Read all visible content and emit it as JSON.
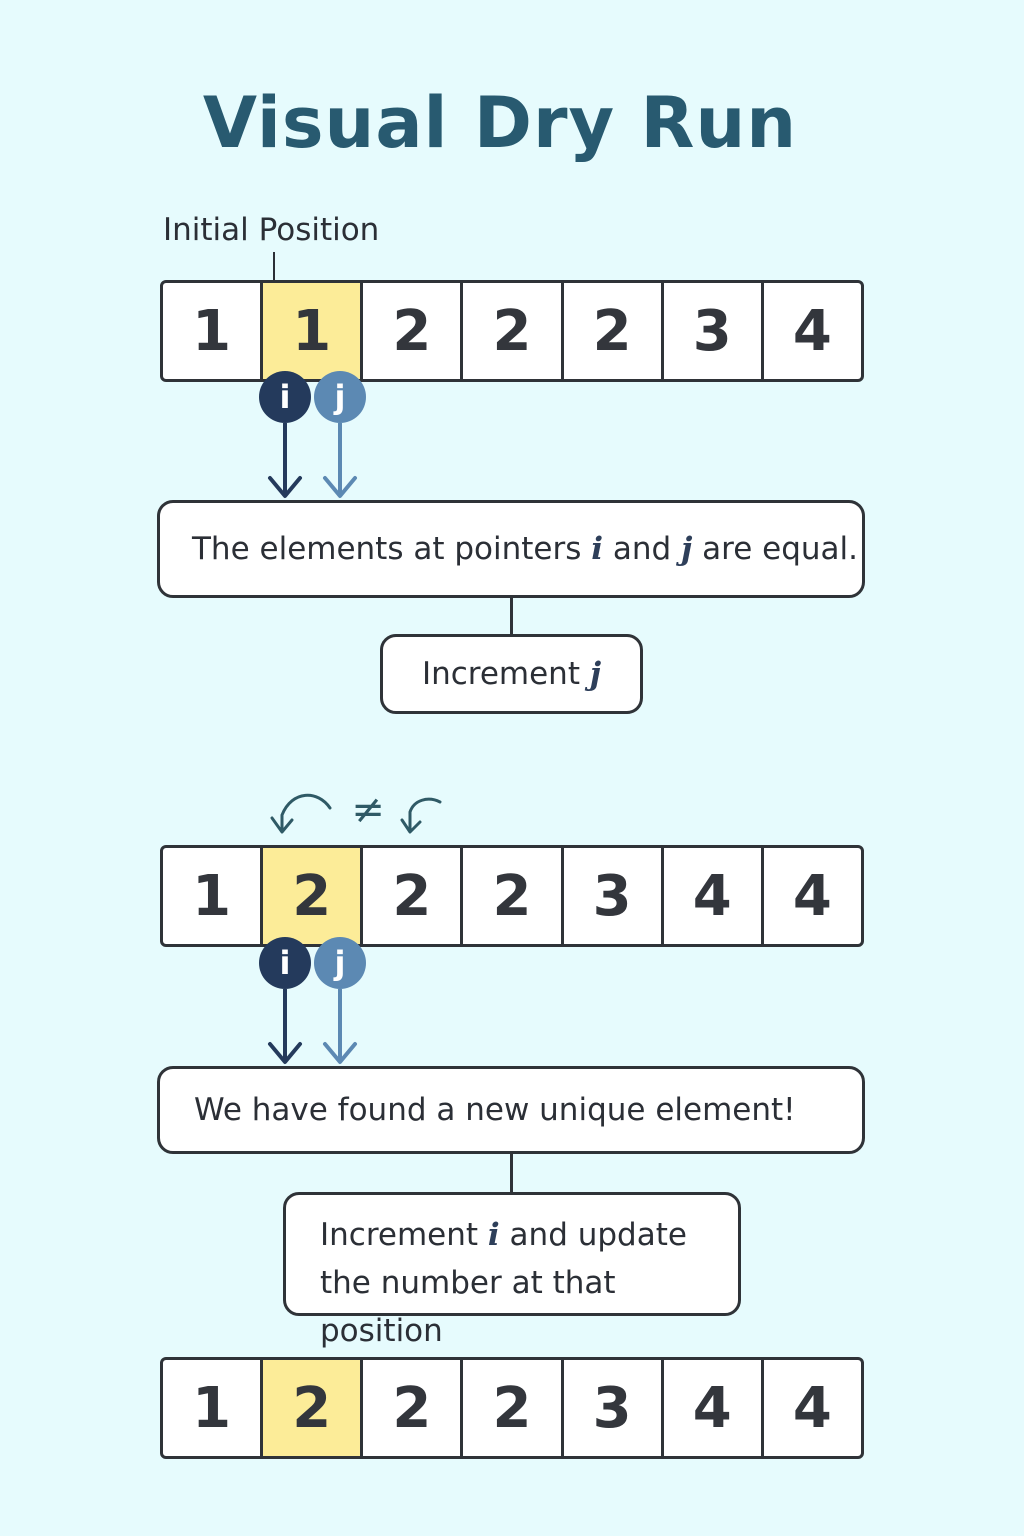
{
  "title": "Visual Dry Run",
  "initial_label": "Initial Position",
  "pointer_i": "i",
  "pointer_j": "j",
  "highlight_color": "#fcec98",
  "pointer_i_color": "#243a5c",
  "pointer_j_color": "#5c89b3",
  "step1": {
    "array": [
      "1",
      "1",
      "2",
      "2",
      "2",
      "3",
      "4"
    ],
    "highlight_index": 1,
    "message_before": "The elements at pointers",
    "message_and": "and",
    "message_after": "are equal.",
    "action_prefix": "Increment",
    "action_var": "j"
  },
  "step2": {
    "annotation": "≠",
    "array": [
      "1",
      "2",
      "2",
      "2",
      "3",
      "4",
      "4"
    ],
    "highlight_index": 1,
    "message": "We have found a new unique element!",
    "action_prefix": "Increment",
    "action_var": "i",
    "action_line1_rest": "and update",
    "action_line2": "the number at that position"
  },
  "step3": {
    "array": [
      "1",
      "2",
      "2",
      "2",
      "3",
      "4",
      "4"
    ],
    "highlight_index": 1
  }
}
